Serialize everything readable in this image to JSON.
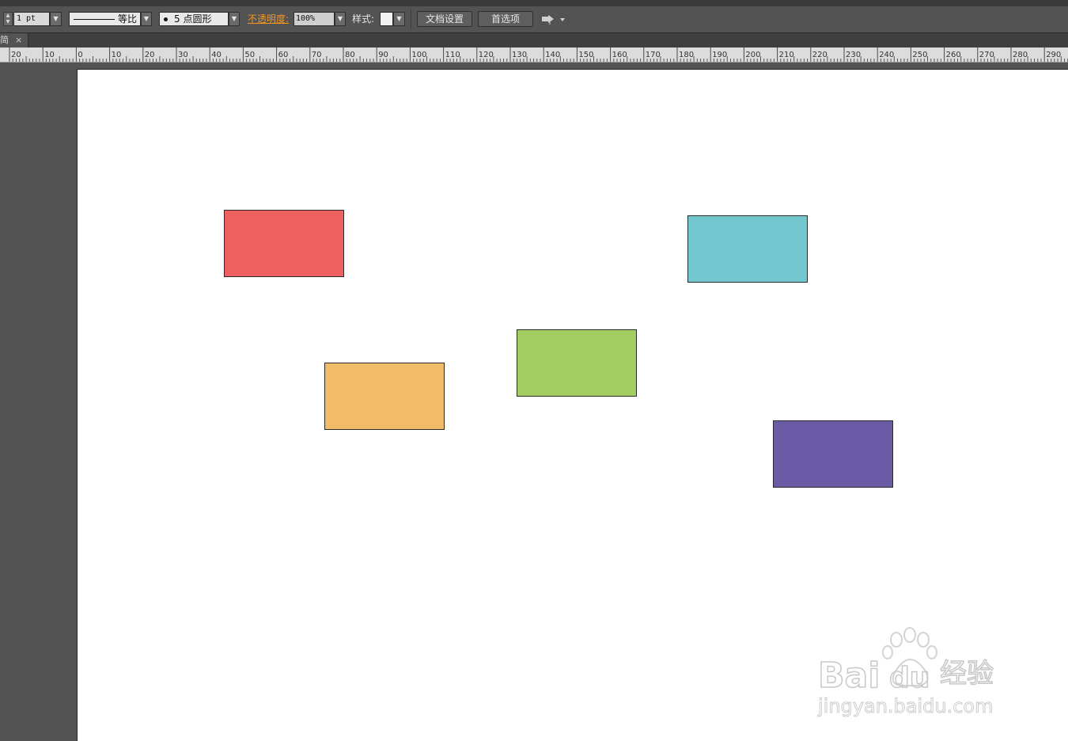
{
  "control_bar": {
    "stroke_weight": "1 pt",
    "stroke_profile_label": "等比",
    "brush_label": "5 点圆形",
    "opacity_label": "不透明度:",
    "opacity_value": "100%",
    "style_label": "样式:",
    "doc_setup_button": "文档设置",
    "preferences_button": "首选项"
  },
  "tab": {
    "title": "简",
    "close": "×"
  },
  "ruler": {
    "labels": [
      "20",
      "10",
      "0",
      "10",
      "20",
      "30",
      "40",
      "50",
      "60",
      "70",
      "80",
      "90",
      "100",
      "110",
      "120",
      "130",
      "140",
      "150",
      "160",
      "170",
      "180",
      "190",
      "200",
      "210",
      "220",
      "230",
      "240",
      "250",
      "260",
      "270",
      "280",
      "290"
    ]
  },
  "artboard": {
    "shapes": [
      {
        "name": "red-rectangle",
        "fill": "#ee6060"
      },
      {
        "name": "cyan-rectangle",
        "fill": "#73c8d0"
      },
      {
        "name": "green-rectangle",
        "fill": "#a3cf62"
      },
      {
        "name": "orange-rectangle",
        "fill": "#f0bc68"
      },
      {
        "name": "purple-rectangle",
        "fill": "#6b5ba7"
      }
    ]
  },
  "watermark": {
    "brand": "Bai",
    "brand2": "du",
    "product": "经验",
    "url": "jingyan.baidu.com"
  },
  "colors": {
    "accent_orange": "#f7941d",
    "ui_dark": "#535353",
    "ruler_bg": "#dcdcdc"
  }
}
